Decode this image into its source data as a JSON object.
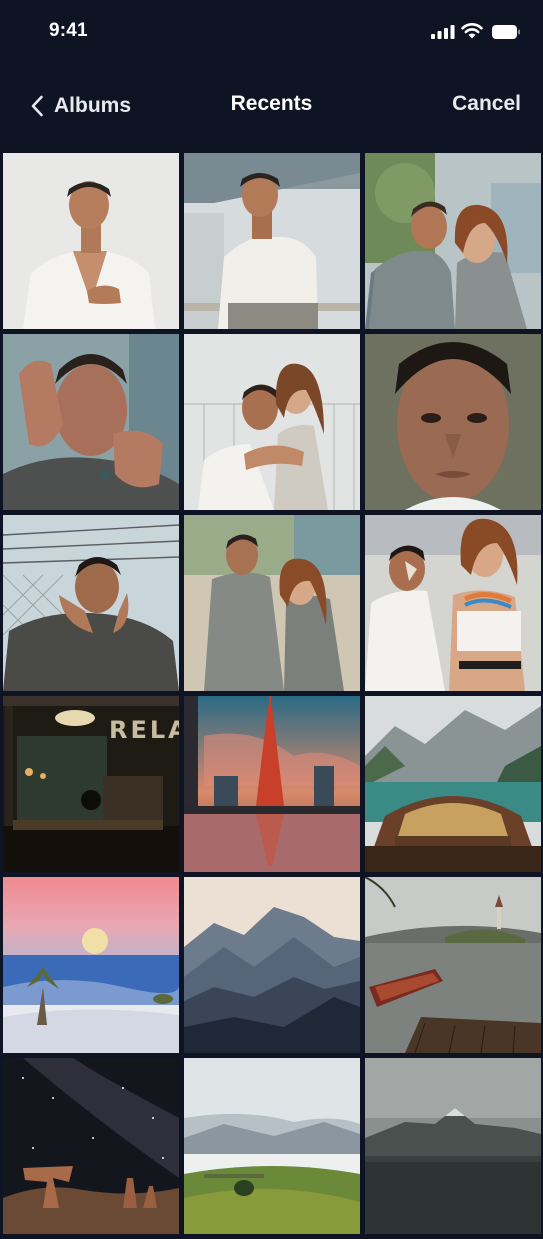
{
  "status_bar": {
    "time": "9:41",
    "icons": [
      "signal-icon",
      "wifi-icon",
      "battery-icon"
    ]
  },
  "nav": {
    "back_label": "Albums",
    "back_icon": "chevron-left-icon",
    "title": "Recents",
    "cancel_label": "Cancel"
  },
  "colors": {
    "background": "#0f1424",
    "text": "#ffffff"
  },
  "photos": [
    {
      "subject": "man in white shirt, studio"
    },
    {
      "subject": "man seated on railing"
    },
    {
      "subject": "couple in tweed jackets"
    },
    {
      "subject": "man with hands on face"
    },
    {
      "subject": "couple embracing by fence"
    },
    {
      "subject": "close-up portrait with face paint"
    },
    {
      "subject": "man by barbed-wire fence"
    },
    {
      "subject": "couple standing outdoors"
    },
    {
      "subject": "couple with body paint"
    },
    {
      "subject": "bar interior with neon sign",
      "sign_text": "RELAX."
    },
    {
      "subject": "city tower at dusk with reflection"
    },
    {
      "subject": "wooden boat on mountain lake"
    },
    {
      "subject": "full moon over desert dunes"
    },
    {
      "subject": "layered mountain ridges"
    },
    {
      "subject": "rowboat at lake pier with island church"
    },
    {
      "subject": "hoodoo rock under milky way"
    },
    {
      "subject": "misty green valley"
    },
    {
      "subject": "mountain over dark lake"
    }
  ]
}
